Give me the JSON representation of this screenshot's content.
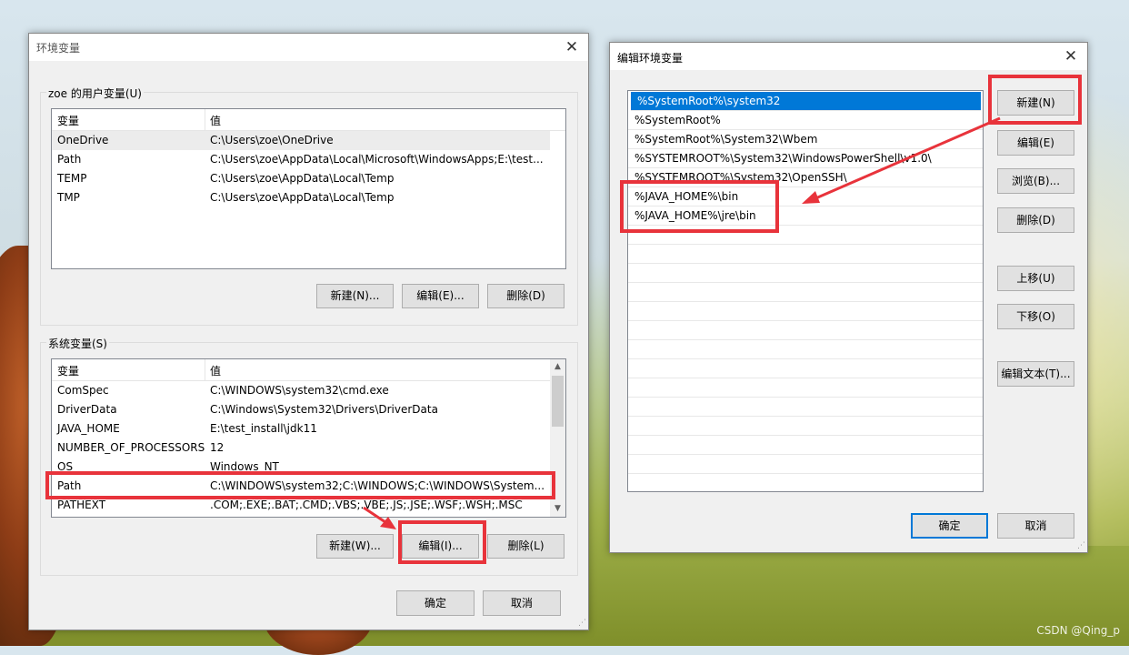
{
  "watermark": "CSDN @Qing_p",
  "env_dialog": {
    "title": "环境变量",
    "user_group": {
      "label": "zoe 的用户变量(U)",
      "col_var": "变量",
      "col_val": "值",
      "rows": [
        {
          "name": "OneDrive",
          "value": "C:\\Users\\zoe\\OneDrive"
        },
        {
          "name": "Path",
          "value": "C:\\Users\\zoe\\AppData\\Local\\Microsoft\\WindowsApps;E:\\test..."
        },
        {
          "name": "TEMP",
          "value": "C:\\Users\\zoe\\AppData\\Local\\Temp"
        },
        {
          "name": "TMP",
          "value": "C:\\Users\\zoe\\AppData\\Local\\Temp"
        }
      ],
      "buttons": {
        "new": "新建(N)...",
        "edit": "编辑(E)...",
        "delete": "删除(D)"
      }
    },
    "system_group": {
      "label": "系统变量(S)",
      "col_var": "变量",
      "col_val": "值",
      "rows": [
        {
          "name": "ComSpec",
          "value": "C:\\WINDOWS\\system32\\cmd.exe"
        },
        {
          "name": "DriverData",
          "value": "C:\\Windows\\System32\\Drivers\\DriverData"
        },
        {
          "name": "JAVA_HOME",
          "value": "E:\\test_install\\jdk11"
        },
        {
          "name": "NUMBER_OF_PROCESSORS",
          "value": "12"
        },
        {
          "name": "OS",
          "value": "Windows_NT"
        },
        {
          "name": "Path",
          "value": "C:\\WINDOWS\\system32;C:\\WINDOWS;C:\\WINDOWS\\System..."
        },
        {
          "name": "PATHEXT",
          "value": ".COM;.EXE;.BAT;.CMD;.VBS;.VBE;.JS;.JSE;.WSF;.WSH;.MSC"
        }
      ],
      "buttons": {
        "new": "新建(W)...",
        "edit": "编辑(I)...",
        "delete": "删除(L)"
      }
    },
    "ok": "确定",
    "cancel": "取消"
  },
  "edit_dialog": {
    "title": "编辑环境变量",
    "entries": [
      "%SystemRoot%\\system32",
      "%SystemRoot%",
      "%SystemRoot%\\System32\\Wbem",
      "%SYSTEMROOT%\\System32\\WindowsPowerShell\\v1.0\\",
      "%SYSTEMROOT%\\System32\\OpenSSH\\",
      "%JAVA_HOME%\\bin",
      "%JAVA_HOME%\\jre\\bin"
    ],
    "buttons": {
      "new": "新建(N)",
      "edit": "编辑(E)",
      "browse": "浏览(B)...",
      "delete": "删除(D)",
      "move_up": "上移(U)",
      "move_down": "下移(O)",
      "edit_text": "编辑文本(T)..."
    },
    "ok": "确定",
    "cancel": "取消"
  }
}
